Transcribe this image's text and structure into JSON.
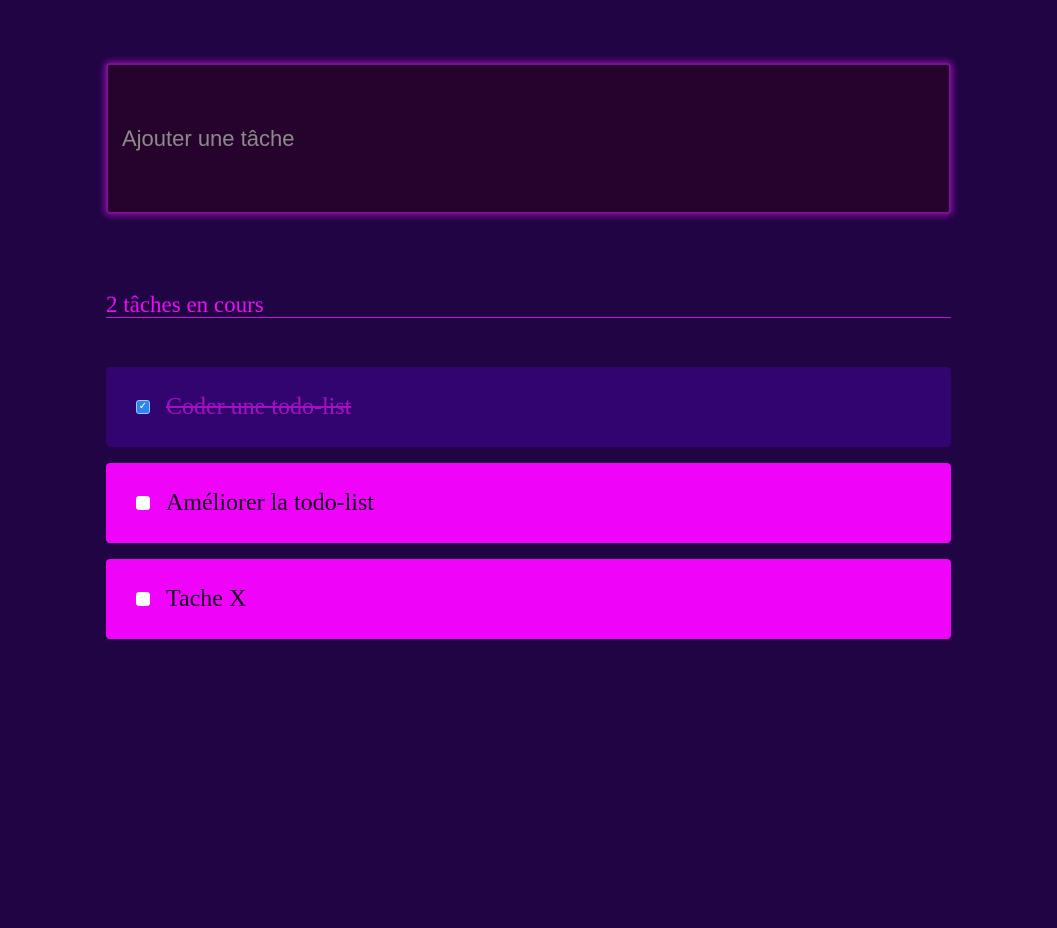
{
  "new_task": {
    "placeholder": "Ajouter une tâche",
    "value": ""
  },
  "counter": {
    "text": "2 tâches en cours"
  },
  "tasks": [
    {
      "label": "Coder une todo-list",
      "completed": true
    },
    {
      "label": "Améliorer la todo-list",
      "completed": false
    },
    {
      "label": "Tache X",
      "completed": false
    }
  ],
  "colors": {
    "background": "#200444",
    "accent": "#f003f9",
    "completed_task_background": "#32046f",
    "input_background": "#26032c",
    "checkbox_checked": "#2d83f0"
  }
}
